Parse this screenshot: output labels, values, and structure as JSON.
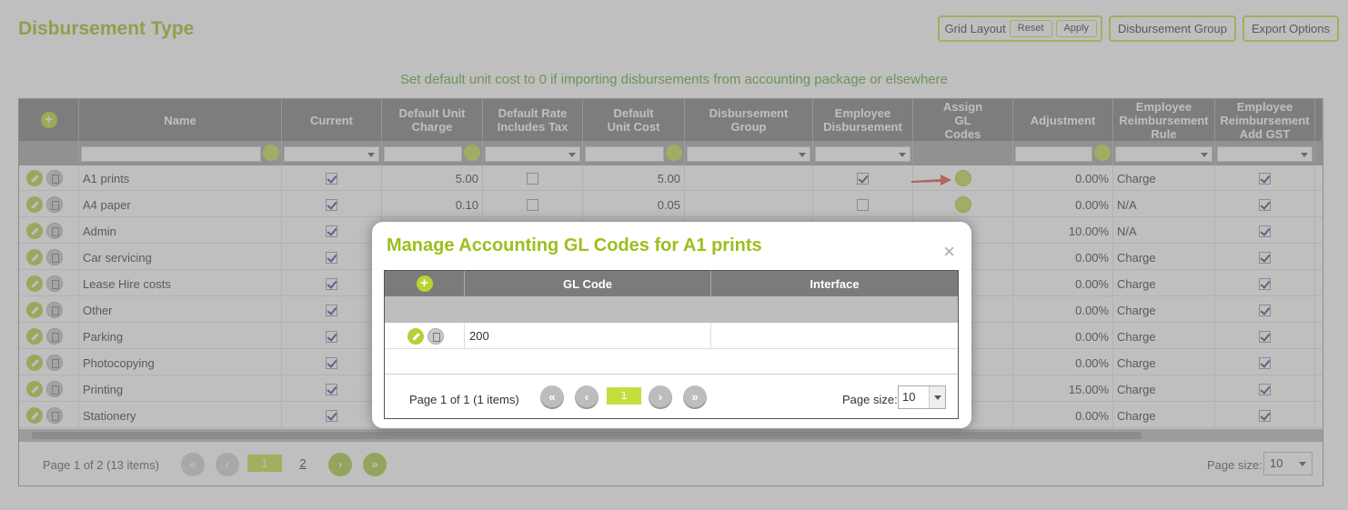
{
  "page": {
    "title": "Disbursement Type",
    "notice": "Set default unit cost to 0 if importing disbursements from accounting package or elsewhere"
  },
  "toolbar": {
    "grid_layout_label": "Grid Layout",
    "reset_label": "Reset",
    "apply_label": "Apply",
    "disbursement_group_label": "Disbursement Group",
    "export_options_label": "Export Options"
  },
  "grid": {
    "columns": [
      "Name",
      "Current",
      "Default Unit Charge",
      "Default Rate Includes Tax",
      "Default Unit Cost",
      "Disbursement Group",
      "Employee Disbursement",
      "Assign GL Codes",
      "Adjustment",
      "Employee Reimbursement Rule",
      "Employee Reimbursement Add GST"
    ],
    "rows": [
      {
        "name": "A1 prints",
        "current": true,
        "unit_charge": "5.00",
        "rate_incl_tax": false,
        "unit_cost": "5.00",
        "emp_disb": true,
        "adjustment": "0.00%",
        "rule": "Charge",
        "add_gst": true
      },
      {
        "name": "A4 paper",
        "current": true,
        "unit_charge": "0.10",
        "rate_incl_tax": false,
        "unit_cost": "0.05",
        "emp_disb": false,
        "adjustment": "0.00%",
        "rule": "N/A",
        "add_gst": true
      },
      {
        "name": "Admin",
        "current": true,
        "unit_charge": "",
        "rate_incl_tax": false,
        "unit_cost": "",
        "emp_disb": false,
        "adjustment": "10.00%",
        "rule": "N/A",
        "add_gst": true
      },
      {
        "name": "Car servicing",
        "current": true,
        "unit_charge": "",
        "rate_incl_tax": false,
        "unit_cost": "",
        "emp_disb": false,
        "adjustment": "0.00%",
        "rule": "Charge",
        "add_gst": true
      },
      {
        "name": "Lease Hire costs",
        "current": true,
        "unit_charge": "",
        "rate_incl_tax": false,
        "unit_cost": "",
        "emp_disb": false,
        "adjustment": "0.00%",
        "rule": "Charge",
        "add_gst": true
      },
      {
        "name": "Other",
        "current": true,
        "unit_charge": "",
        "rate_incl_tax": false,
        "unit_cost": "",
        "emp_disb": false,
        "adjustment": "0.00%",
        "rule": "Charge",
        "add_gst": true
      },
      {
        "name": "Parking",
        "current": true,
        "unit_charge": "",
        "rate_incl_tax": false,
        "unit_cost": "",
        "emp_disb": false,
        "adjustment": "0.00%",
        "rule": "Charge",
        "add_gst": true
      },
      {
        "name": "Photocopying",
        "current": true,
        "unit_charge": "",
        "rate_incl_tax": false,
        "unit_cost": "",
        "emp_disb": false,
        "adjustment": "0.00%",
        "rule": "Charge",
        "add_gst": true
      },
      {
        "name": "Printing",
        "current": true,
        "unit_charge": "",
        "rate_incl_tax": false,
        "unit_cost": "",
        "emp_disb": false,
        "adjustment": "15.00%",
        "rule": "Charge",
        "add_gst": true
      },
      {
        "name": "Stationery",
        "current": true,
        "unit_charge": "",
        "rate_incl_tax": false,
        "unit_cost": "",
        "emp_disb": false,
        "adjustment": "0.00%",
        "rule": "Charge",
        "add_gst": true
      }
    ],
    "pager": {
      "info": "Page 1 of 2 (13 items)",
      "page_current": "1",
      "page_other": "2",
      "page_size_label": "Page size:",
      "page_size_value": "10"
    }
  },
  "modal": {
    "title": "Manage Accounting GL Codes for A1 prints",
    "close_glyph": "×",
    "columns": [
      "GL Code",
      "Interface"
    ],
    "rows": [
      {
        "gl_code": "200",
        "interface": ""
      }
    ],
    "pager": {
      "info": "Page 1 of 1 (1 items)",
      "page_current": "1",
      "page_size_label": "Page size:",
      "page_size_value": "10"
    }
  },
  "icons": {
    "add": "plus-circle-icon",
    "edit": "pencil-icon",
    "delete": "trash-icon",
    "search": "search-icon",
    "first": "first-page-icon",
    "prev": "prev-page-icon",
    "next": "next-page-icon",
    "last": "last-page-icon"
  },
  "colors": {
    "accent": "#9cbf1c",
    "notice": "#5fa436",
    "header": "#7b7b7b",
    "arrow": "#e8473a"
  }
}
